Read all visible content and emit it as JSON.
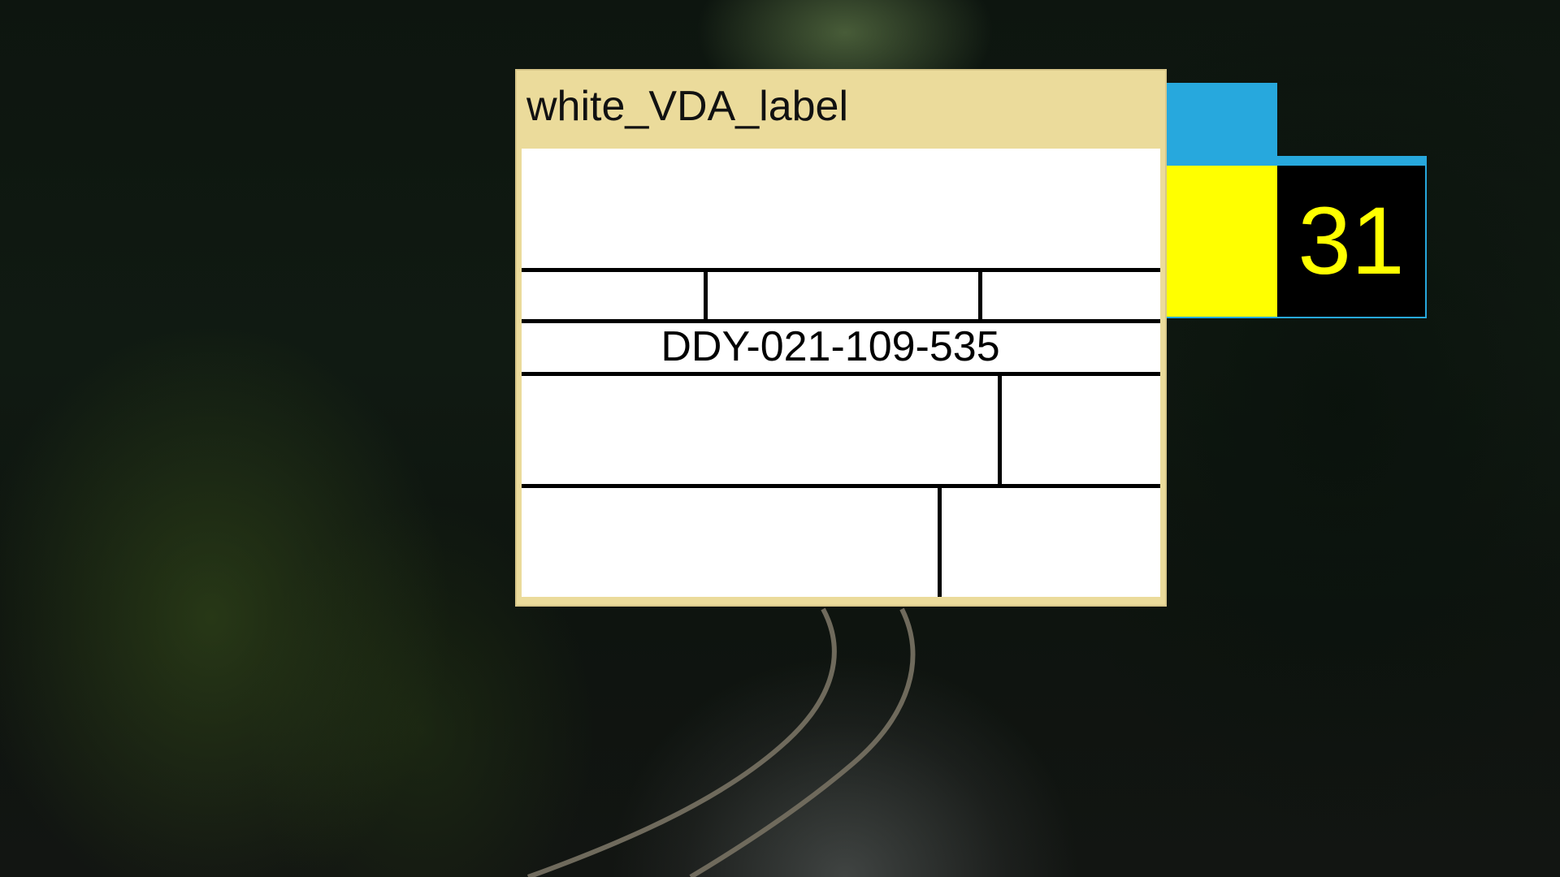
{
  "window": {
    "title": "white_VDA_label"
  },
  "label": {
    "part_number": "DDY-021-109-535"
  },
  "background_widget": {
    "number": "31",
    "colors": {
      "frame": "#27a8dd",
      "left_cell": "#ffff00",
      "right_cell": "#000000",
      "digits": "#ffff00"
    }
  },
  "colors": {
    "window_title_bar": "#ebdb9b",
    "label_background": "#ffffff",
    "grid_lines": "#000000"
  }
}
